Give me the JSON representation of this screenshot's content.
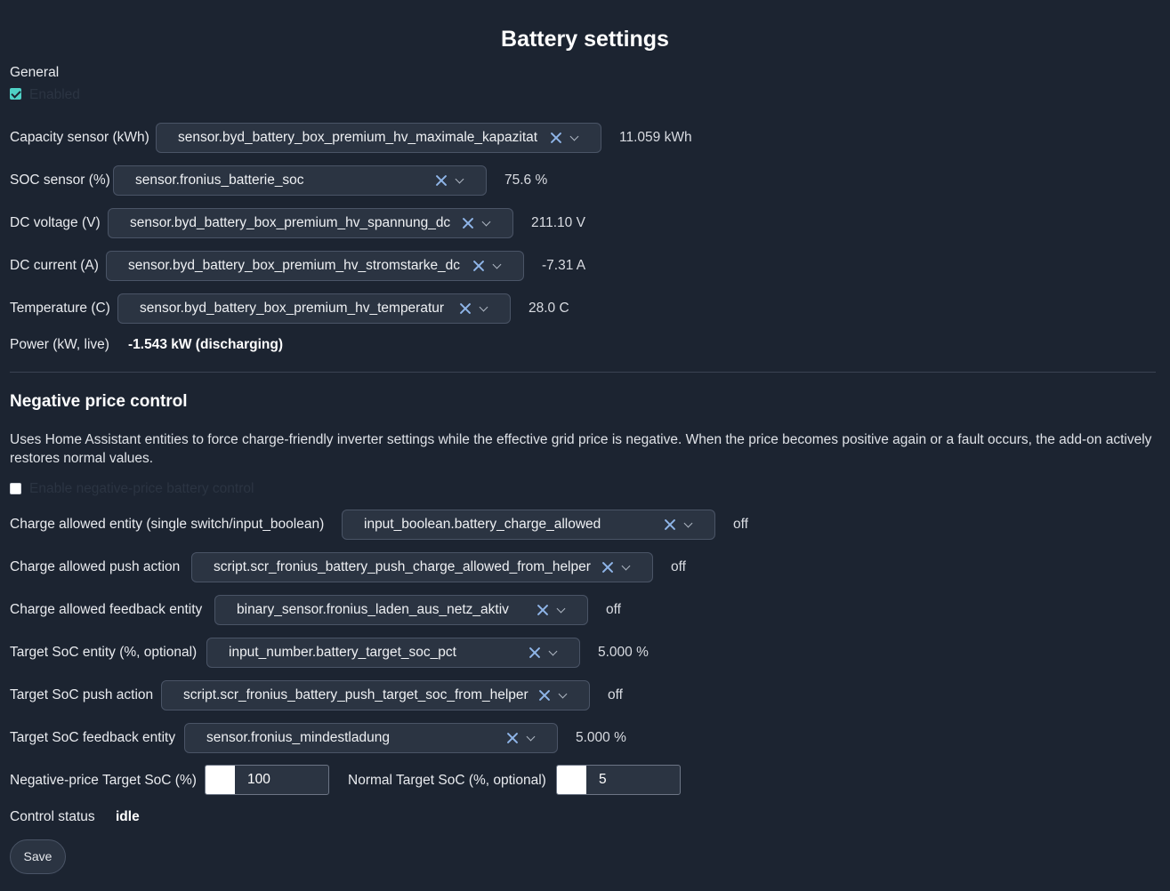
{
  "page": {
    "title": "Battery settings"
  },
  "general": {
    "heading": "General",
    "enabled_label": "Enabled",
    "enabled_checked": true,
    "rows": [
      {
        "label": "Capacity sensor (kWh)",
        "entity": "sensor.byd_battery_box_premium_hv_maximale_kapazitat",
        "value": "11.059 kWh"
      },
      {
        "label": "SOC sensor (%)",
        "entity": "sensor.fronius_batterie_soc",
        "value": "75.6 %"
      },
      {
        "label": "DC voltage (V)",
        "entity": "sensor.byd_battery_box_premium_hv_spannung_dc",
        "value": "211.10 V"
      },
      {
        "label": "DC current (A)",
        "entity": "sensor.byd_battery_box_premium_hv_stromstarke_dc",
        "value": "-7.31 A"
      },
      {
        "label": "Temperature (C)",
        "entity": "sensor.byd_battery_box_premium_hv_temperatur",
        "value": "28.0 C"
      }
    ],
    "power": {
      "label": "Power (kW, live)",
      "value": "-1.543 kW (discharging)"
    }
  },
  "negative_price": {
    "heading": "Negative price control",
    "description": "Uses Home Assistant entities to force charge-friendly inverter settings while the effective grid price is negative. When the price becomes positive again or a fault occurs, the add-on actively restores normal values.",
    "enable_label": "Enable negative-price battery control",
    "enable_checked": false,
    "rows": [
      {
        "label": "Charge allowed entity (single switch/input_boolean)",
        "entity": "input_boolean.battery_charge_allowed",
        "value": "off"
      },
      {
        "label": "Charge allowed push action",
        "entity": "script.scr_fronius_battery_push_charge_allowed_from_helper",
        "value": "off"
      },
      {
        "label": "Charge allowed feedback entity",
        "entity": "binary_sensor.fronius_laden_aus_netz_aktiv",
        "value": "off"
      },
      {
        "label": "Target SoC entity (%, optional)",
        "entity": "input_number.battery_target_soc_pct",
        "value": "5.000 %"
      },
      {
        "label": "Target SoC push action",
        "entity": "script.scr_fronius_battery_push_target_soc_from_helper",
        "value": "off"
      },
      {
        "label": "Target SoC feedback entity",
        "entity": "sensor.fronius_mindestladung",
        "value": "5.000 %"
      }
    ],
    "neg_target": {
      "label": "Negative-price Target SoC (%)",
      "value": "100"
    },
    "normal_target": {
      "label": "Normal Target SoC (%, optional)",
      "value": "5"
    },
    "status": {
      "label": "Control status",
      "value": "idle"
    }
  },
  "actions": {
    "save_label": "Save"
  },
  "colors": {
    "background": "#1c2431",
    "field": "#2b3442",
    "accent": "#4fd1c5",
    "clear_icon": "#8fb5e8"
  }
}
